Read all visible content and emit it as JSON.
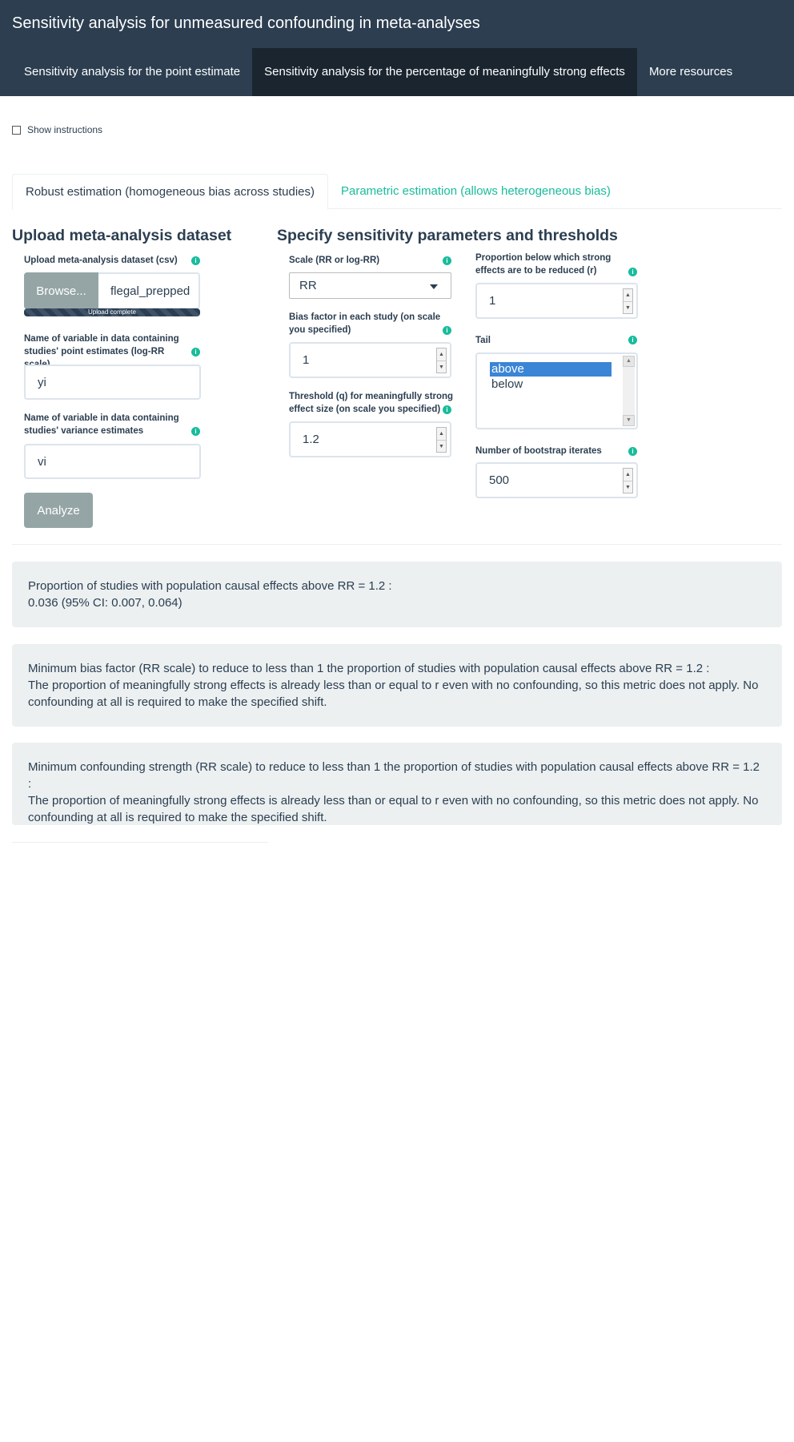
{
  "app": {
    "title": "Sensitivity analysis for unmeasured confounding in meta-analyses",
    "tabs": [
      "Sensitivity analysis for the point estimate",
      "Sensitivity analysis for the percentage of meaningfully strong effects",
      "More resources"
    ],
    "active_tab": 1
  },
  "show_instructions": {
    "label": "Show instructions",
    "checked": false
  },
  "inner_tabs": [
    "Robust estimation (homogeneous bias across studies)",
    "Parametric estimation (allows heterogeneous bias)"
  ],
  "upload": {
    "heading": "Upload meta-analysis dataset",
    "file_label": "Upload meta-analysis dataset (csv)",
    "browse": "Browse...",
    "file_name": "flegal_prepped",
    "progress": "Upload complete",
    "yi_label": "Name of variable in data containing studies' point estimates (log-RR scale)",
    "yi_value": "yi",
    "vi_label": "Name of variable in data containing studies' variance estimates",
    "vi_value": "vi",
    "analyze": "Analyze"
  },
  "params": {
    "heading": "Specify sensitivity parameters and thresholds",
    "scale_label": "Scale (RR or log-RR)",
    "scale_value": "RR",
    "bias_label": "Bias factor in each study (on scale you specified)",
    "bias_value": "1",
    "q_label": "Threshold (q) for meaningfully strong effect size (on scale you specified)",
    "q_value": "1.2",
    "r_label": "Proportion below which strong effects are to be reduced (r)",
    "r_value": "1",
    "tail_label": "Tail",
    "tail_options": [
      "above",
      "below"
    ],
    "tail_selected": "above",
    "boot_label": "Number of bootstrap iterates",
    "boot_value": "500"
  },
  "results": [
    {
      "title": "Proportion of studies with population causal effects above RR = 1.2 :",
      "body": "0.036 (95% CI: 0.007, 0.064)"
    },
    {
      "title": "Minimum bias factor (RR scale) to reduce to less than 1 the proportion of studies with population causal effects above RR = 1.2 :",
      "body": "The proportion of meaningfully strong effects is already less than or equal to r even with no confounding, so this metric does not apply. No confounding at all is required to make the specified shift."
    },
    {
      "title": "Minimum confounding strength (RR scale) to reduce to less than 1 the proportion of studies with population causal effects above RR = 1.2 :",
      "body": "The proportion of meaningfully strong effects is already less than or equal to r even with no confounding, so this metric does not apply. No confounding at all is required to make the specified shift."
    }
  ],
  "colors": {
    "navbar": "#2c3e50",
    "active_nav": "#1a252f",
    "accent": "#18bc9c",
    "well": "#ecf0f1",
    "button": "#95a5a6"
  }
}
